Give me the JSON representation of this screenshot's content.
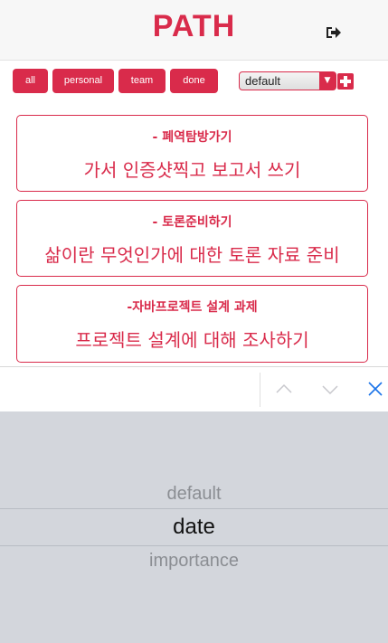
{
  "header": {
    "title": "PATH",
    "logout_icon": "sign-out-icon"
  },
  "filters": {
    "all": "all",
    "personal": "personal",
    "team": "team",
    "done": "done"
  },
  "sort": {
    "selected": "default",
    "add_icon": "plus-icon"
  },
  "tasks": [
    {
      "title": "- 폐역탐방가기",
      "desc": "가서 인증샷찍고 보고서 쓰기"
    },
    {
      "title": "- 토론준비하기",
      "desc": "삶이란 무엇인가에 대한 토론 자료 준비"
    },
    {
      "title": "-자바프로젝트 설계 과제",
      "desc": "프로젝트 설계에 대해 조사하기"
    }
  ],
  "accessory": {
    "prev_icon": "chevron-up-icon",
    "next_icon": "chevron-down-icon",
    "close_icon": "close-icon"
  },
  "picker": {
    "options": [
      "default",
      "date",
      "importance"
    ],
    "selected": "date"
  },
  "colors": {
    "accent": "#d92b4b",
    "picker_bg": "#d3d6dc"
  }
}
